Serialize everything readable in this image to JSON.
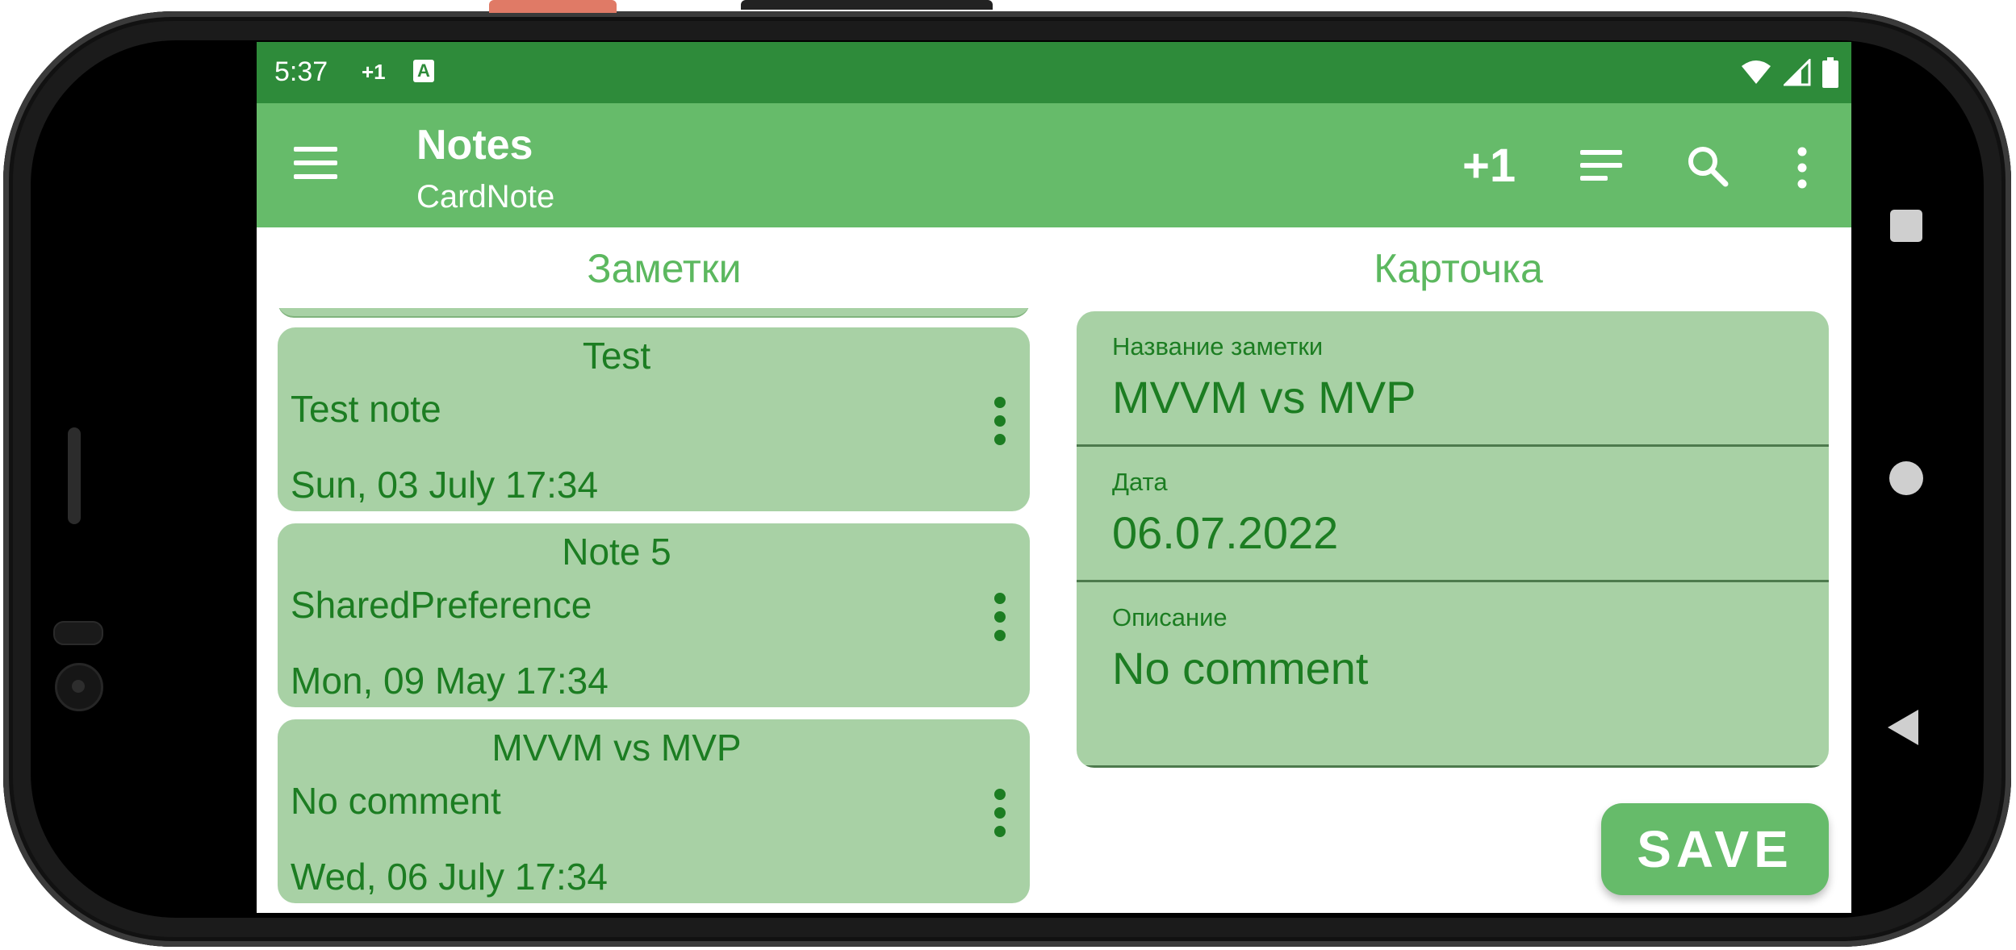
{
  "status_bar": {
    "time": "5:37",
    "notification_plus": "+1",
    "notification_icon": "A",
    "icons": [
      "wifi-icon",
      "signal-icon",
      "battery-icon"
    ]
  },
  "app_bar": {
    "title": "Notes",
    "subtitle": "CardNote",
    "actions": {
      "plus_one": "+1",
      "sort_icon": "sort-icon",
      "search_icon": "search-icon",
      "more_icon": "more-vert-icon"
    }
  },
  "notes_panel": {
    "title": "Заметки",
    "notes": [
      {
        "title": "Test",
        "description": "Test note",
        "date": "Sun, 03 July  17:34"
      },
      {
        "title": "Note 5",
        "description": "SharedPreference",
        "date": "Mon, 09 May  17:34"
      },
      {
        "title": "MVVM vs MVP",
        "description": "No comment",
        "date": "Wed, 06 July  17:34"
      }
    ]
  },
  "card_panel": {
    "title": "Карточка",
    "fields": {
      "name": {
        "label": "Название заметки",
        "value": "MVVM vs MVP"
      },
      "date": {
        "label": "Дата",
        "value": "06.07.2022"
      },
      "description": {
        "label": "Описание",
        "value": "No comment"
      }
    },
    "save_label": "SAVE"
  },
  "colors": {
    "status_bar": "#2e8b3a",
    "app_bar": "#66bb6a",
    "card_bg": "#a8d1a5",
    "text_green": "#1c7d22",
    "header_green": "#5cb85f"
  }
}
